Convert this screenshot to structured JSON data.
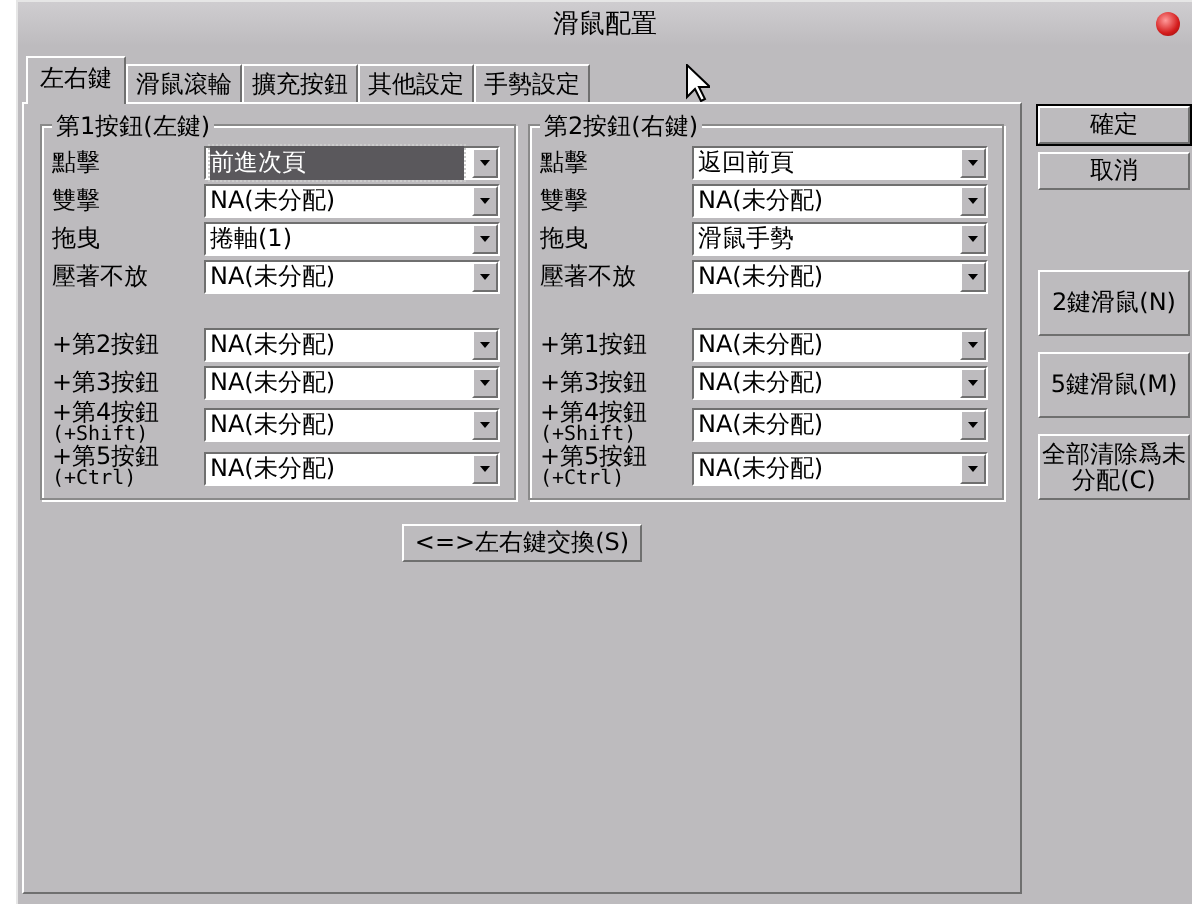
{
  "window": {
    "title": "滑鼠配置"
  },
  "tabs": [
    {
      "label": "左右鍵",
      "selected": true
    },
    {
      "label": "滑鼠滾輪",
      "selected": false
    },
    {
      "label": "擴充按鈕",
      "selected": false
    },
    {
      "label": "其他設定",
      "selected": false
    },
    {
      "label": "手勢設定",
      "selected": false
    }
  ],
  "groups": [
    {
      "title": "第1按鈕(左鍵)",
      "rows": [
        {
          "label": "點擊",
          "value": "前進次頁",
          "focused": true
        },
        {
          "label": "雙擊",
          "value": "NA(未分配)",
          "focused": false
        },
        {
          "label": "拖曳",
          "value": "捲軸(1)",
          "focused": false
        },
        {
          "label": "壓著不放",
          "value": "NA(未分配)",
          "focused": false
        }
      ],
      "combo_rows": [
        {
          "label": "+第2按鈕",
          "value": "NA(未分配)",
          "focused": false
        },
        {
          "label": "+第3按鈕",
          "value": "NA(未分配)",
          "focused": false
        },
        {
          "label": "+第4按鈕",
          "sublabel": "(+Shift)",
          "value": "NA(未分配)",
          "focused": false
        },
        {
          "label": "+第5按鈕",
          "sublabel": "(+Ctrl)",
          "value": "NA(未分配)",
          "focused": false
        }
      ]
    },
    {
      "title": "第2按鈕(右鍵)",
      "rows": [
        {
          "label": "點擊",
          "value": "返回前頁",
          "focused": false
        },
        {
          "label": "雙擊",
          "value": "NA(未分配)",
          "focused": false
        },
        {
          "label": "拖曳",
          "value": "滑鼠手勢",
          "focused": false
        },
        {
          "label": "壓著不放",
          "value": "NA(未分配)",
          "focused": false
        }
      ],
      "combo_rows": [
        {
          "label": "+第1按鈕",
          "value": "NA(未分配)",
          "focused": false
        },
        {
          "label": "+第3按鈕",
          "value": "NA(未分配)",
          "focused": false
        },
        {
          "label": "+第4按鈕",
          "sublabel": "(+Shift)",
          "value": "NA(未分配)",
          "focused": false
        },
        {
          "label": "+第5按鈕",
          "sublabel": "(+Ctrl)",
          "value": "NA(未分配)",
          "focused": false
        }
      ]
    }
  ],
  "swap_button": "<=>左右鍵交換(S)",
  "dialog_buttons": [
    {
      "label": "確定",
      "default": true
    },
    {
      "label": "取消",
      "default": false
    }
  ],
  "preset_buttons": [
    "2鍵滑鼠(N)",
    "5鍵滑鼠(M)",
    "全部清除爲未分配(C)"
  ]
}
